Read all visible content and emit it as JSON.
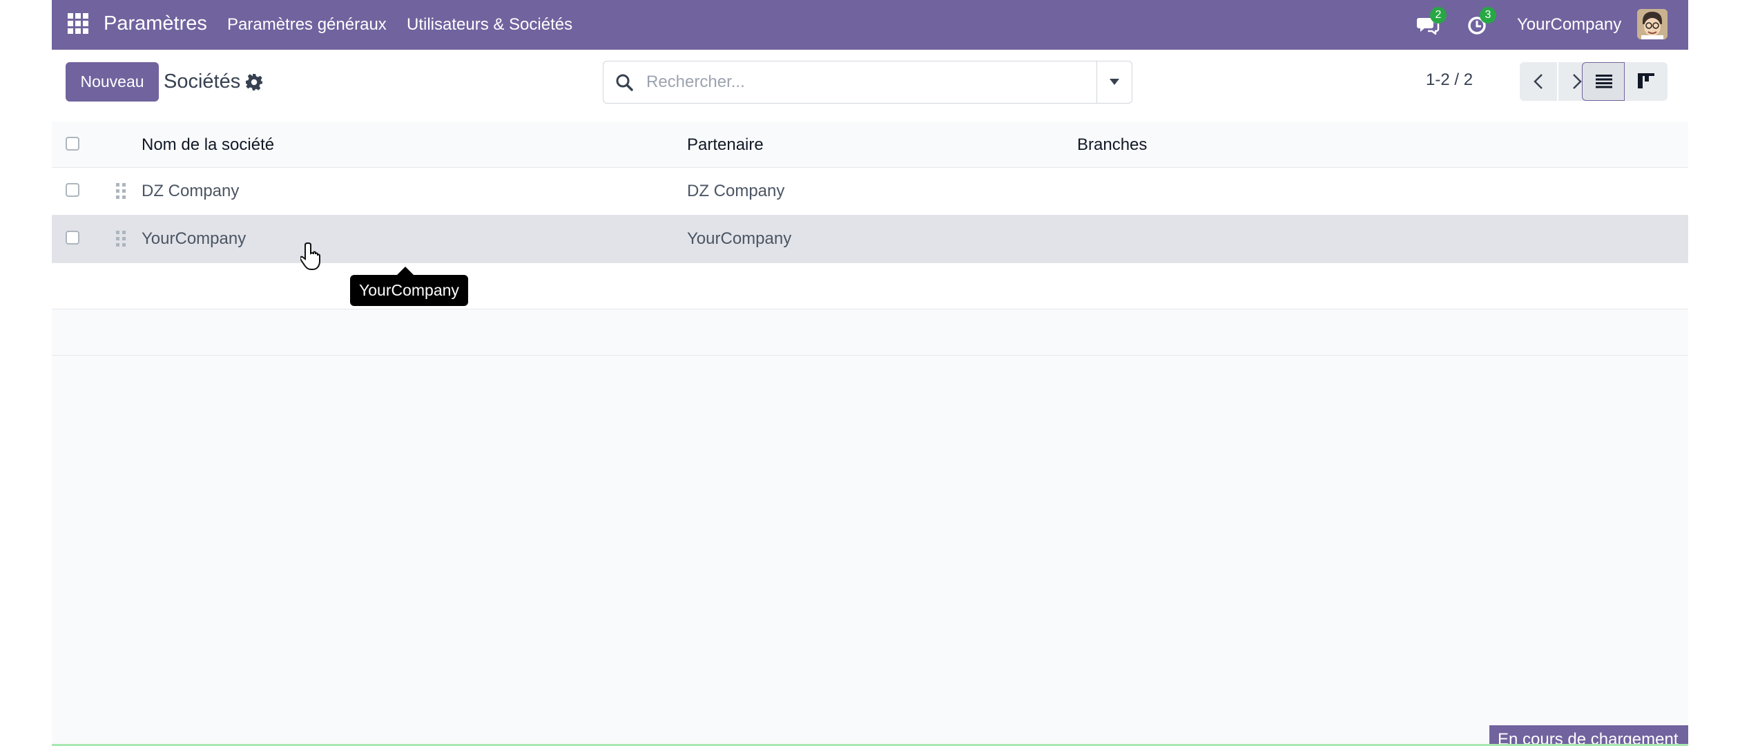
{
  "navbar": {
    "app_title": "Paramètres",
    "menu": [
      "Paramètres généraux",
      "Utilisateurs & Sociétés"
    ],
    "messages_badge": "2",
    "activities_badge": "3",
    "company": "YourCompany"
  },
  "control": {
    "new_button": "Nouveau",
    "breadcrumb": "Sociétés",
    "search_placeholder": "Rechercher...",
    "pager": "1-2 / 2"
  },
  "table": {
    "headers": [
      "Nom de la société",
      "Partenaire",
      "Branches"
    ],
    "rows": [
      {
        "name": "DZ Company",
        "partner": "DZ Company",
        "branches": ""
      },
      {
        "name": "YourCompany",
        "partner": "YourCompany",
        "branches": ""
      }
    ]
  },
  "tooltip": "YourCompany",
  "status": "En cours de chargement",
  "colors": {
    "brand": "#71639e",
    "badge": "#28a745"
  }
}
